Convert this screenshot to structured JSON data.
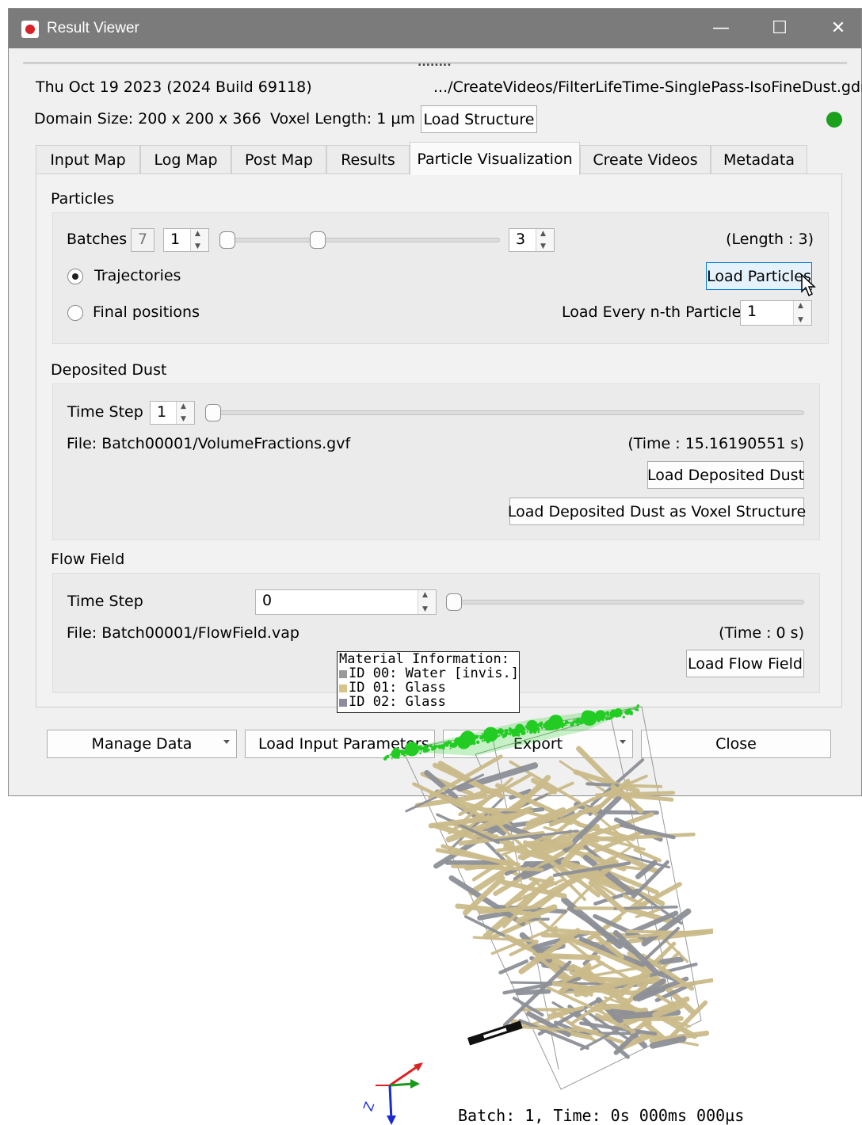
{
  "window": {
    "title": "Result Viewer",
    "minimize": "—",
    "maximize": "☐",
    "close": "✕",
    "splitter": "........"
  },
  "header": {
    "build": "Thu Oct 19 2023 (2024 Build 69118)",
    "path": ".../CreateVideos/FilterLifeTime-SinglePass-IsoFineDust.gdr",
    "domain_size": "Domain Size: 200 x 200 x 366",
    "voxel_length": "Voxel Length: 1 µm",
    "load_structure": "Load Structure",
    "status_color": "#1aa01a"
  },
  "tabs": [
    "Input Map",
    "Log Map",
    "Post Map",
    "Results",
    "Particle Visualization",
    "Create Videos",
    "Metadata"
  ],
  "active_tab": "Particle Visualization",
  "particles": {
    "title": "Particles",
    "batches_label": "Batches",
    "batches_total": "7",
    "batch_from": "1",
    "batch_to": "3",
    "length_text": "(Length : 3)",
    "slider_low": 0,
    "slider_high": 0.33,
    "trajectories": "Trajectories",
    "final_positions": "Final positions",
    "selected_mode": "Trajectories",
    "load_particles": "Load Particles",
    "load_every_label": "Load Every n-th Particle",
    "load_every_value": "1"
  },
  "deposited": {
    "title": "Deposited Dust",
    "time_step_label": "Time Step",
    "time_step_value": "1",
    "file": "File: Batch00001/VolumeFractions.gvf",
    "time": "(Time : 15.16190551 s)",
    "load_button": "Load Deposited Dust",
    "load_voxel_button": "Load Deposited Dust as Voxel Structure"
  },
  "flow": {
    "title": "Flow Field",
    "time_step_label": "Time Step",
    "time_step_value": "0",
    "file": "File: Batch00001/FlowField.vap",
    "time": "(Time : 0 s)",
    "load_button": "Load Flow Field"
  },
  "bottom": {
    "manage": "Manage Data",
    "load_input": "Load Input Parameters",
    "export": "Export",
    "close": "Close"
  },
  "legend": {
    "title": "Material Information:",
    "items": [
      "ID 00: Water [invis.]",
      "ID 01: Glass",
      "ID 02: Glass"
    ],
    "colors": [
      "#9a9a9a",
      "#d8c48a",
      "#8c8c9c"
    ]
  },
  "viewer": {
    "status": "Batch: 1, Time:  0s 000ms 000µs",
    "axis_label": "Z"
  },
  "colors": {
    "dust": "#22cc22",
    "fiber_tan": "#cbbb8a",
    "fiber_gray": "#8d9097",
    "accent": "#0078d7"
  }
}
